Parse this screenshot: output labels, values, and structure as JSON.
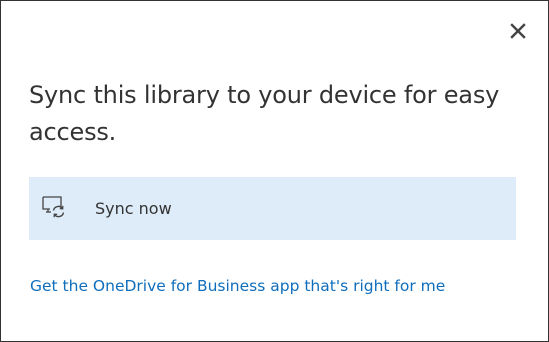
{
  "dialog": {
    "title": "Sync this library to your device for easy access.",
    "close_icon": "close-icon",
    "sync_action": {
      "icon": "sync-device-icon",
      "label": "Sync now"
    },
    "app_link": "Get the OneDrive for Business app that's right for me"
  },
  "colors": {
    "text": "#333333",
    "sync_row_background": "#deecf9",
    "link": "#0f6ebc",
    "border": "#333333"
  }
}
